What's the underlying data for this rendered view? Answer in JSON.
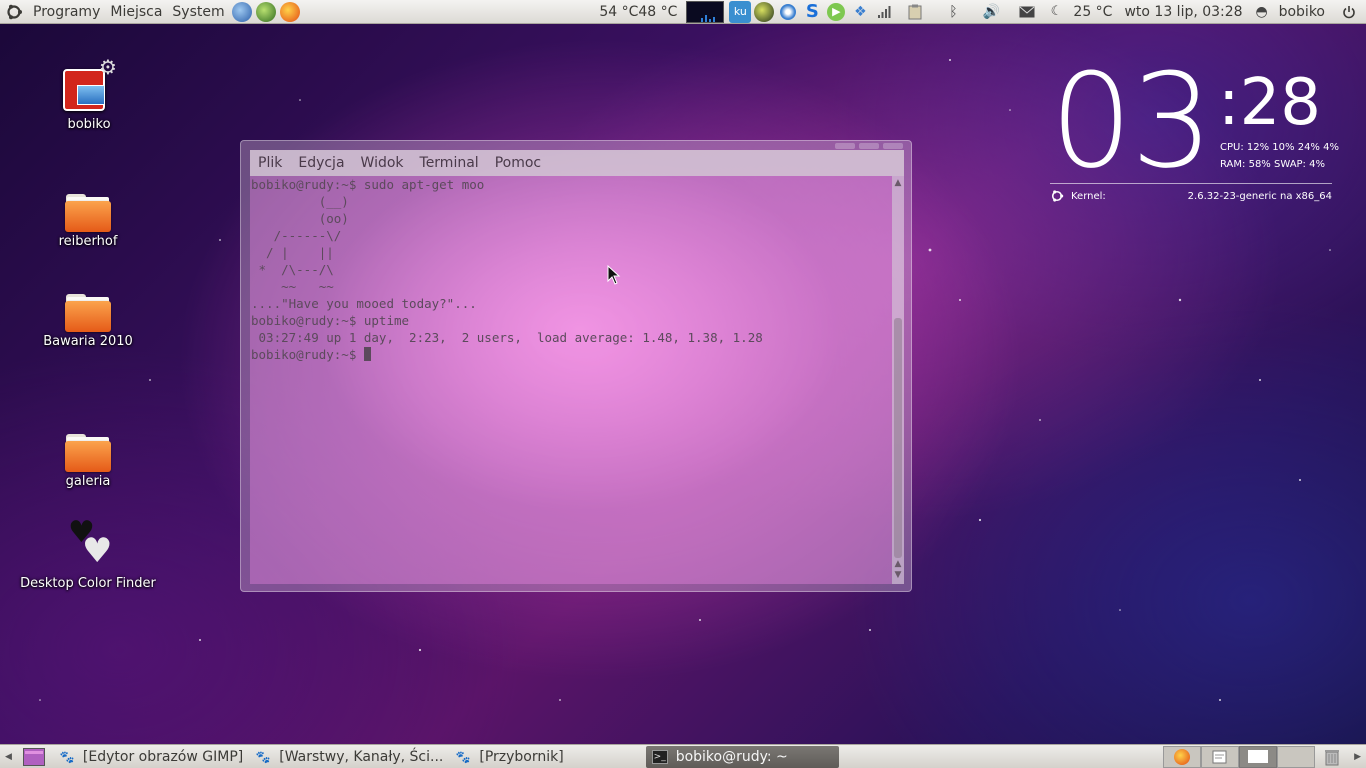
{
  "top_panel": {
    "menus": [
      "Programy",
      "Miejsca",
      "System"
    ],
    "temps": "54 °C48 °C",
    "weather": "25 °C",
    "datetime": "wto 13 lip, 03:28",
    "user": "bobiko",
    "tray_badge": "ku"
  },
  "desktop_icons": {
    "bobiko": "bobiko",
    "reiberhof": "reiberhof",
    "bawaria": "Bawaria 2010",
    "galeria": "galeria",
    "color_finder": "Desktop Color Finder"
  },
  "terminal": {
    "menu": [
      "Plik",
      "Edycja",
      "Widok",
      "Terminal",
      "Pomoc"
    ],
    "lines": [
      "bobiko@rudy:~$ sudo apt-get moo",
      "         (__)",
      "         (oo)",
      "   /------\\/",
      "  / |    ||",
      " *  /\\---/\\",
      "    ~~   ~~",
      "....\"Have you mooed today?\"...",
      "bobiko@rudy:~$ uptime",
      " 03:27:49 up 1 day,  2:23,  2 users,  load average: 1.48, 1.38, 1.28"
    ],
    "prompt": "bobiko@rudy:~$ "
  },
  "clock_widget": {
    "hours": "03",
    "minutes": ":28",
    "cpu_label": "CPU:",
    "cpu_values": "12% 10% 24% 4%",
    "ram_label": "RAM:",
    "ram_value": "58%",
    "swap_label": "SWAP:",
    "swap_value": "4%",
    "kernel_label": "Kernel:",
    "kernel_value": "2.6.32-23-generic na x86_64"
  },
  "taskbar": {
    "tasks": [
      "[Edytor obrazów GIMP]",
      "[Warstwy, Kanały, Ści...",
      "[Przybornik]",
      "bobiko@rudy: ~"
    ]
  },
  "colors": {
    "accent": "#dd4814",
    "panel": "#dcdad5"
  }
}
